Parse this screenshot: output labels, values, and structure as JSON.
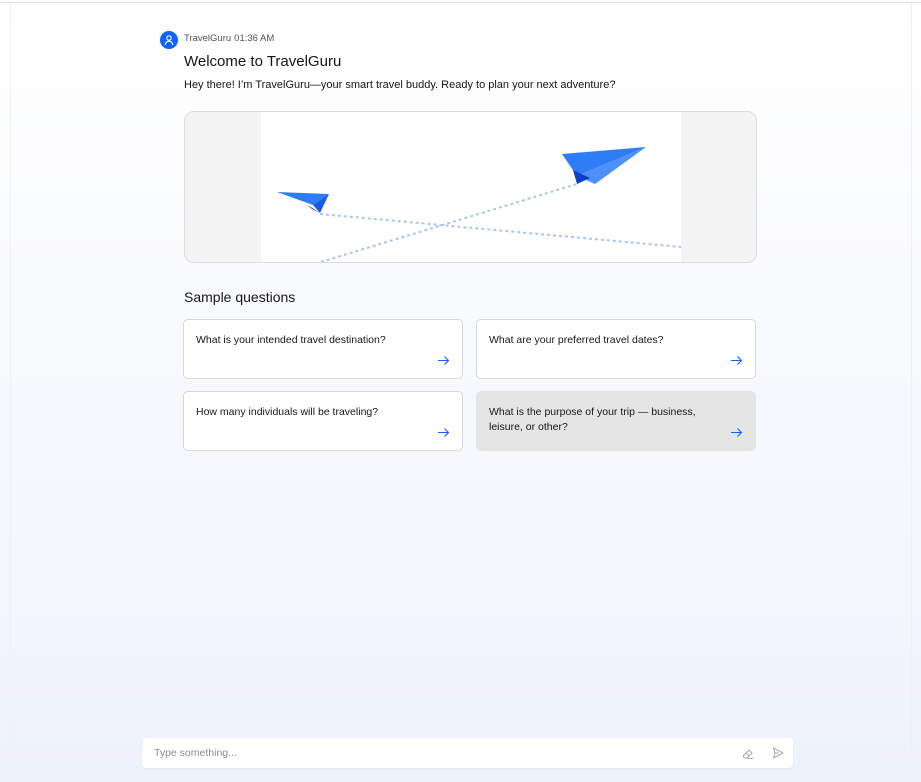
{
  "colors": {
    "accent": "#0f62fe",
    "plane": "#2e7cf6",
    "plane_dark": "#0f3fc6",
    "hover_card": "#e5e5e5"
  },
  "message": {
    "sender": "TravelGuru",
    "time": "01:36 AM",
    "title": "Welcome to TravelGuru",
    "body": "Hey there! I’m TravelGuru—your smart travel buddy. Ready to plan your next adventure?",
    "avatar_icon": "user-icon",
    "image_icon": "paper-plane-icon"
  },
  "sample_questions": {
    "title": "Sample questions",
    "arrow_icon": "arrow-right-icon",
    "items": [
      "What is your intended travel destination?",
      "What are your preferred travel dates?",
      "How many individuals will be traveling?",
      "What is the purpose of your trip — business, leisure, or other?"
    ]
  },
  "input": {
    "placeholder": "Type something...",
    "value": "",
    "clear_icon": "eraser-icon",
    "send_icon": "send-icon"
  }
}
